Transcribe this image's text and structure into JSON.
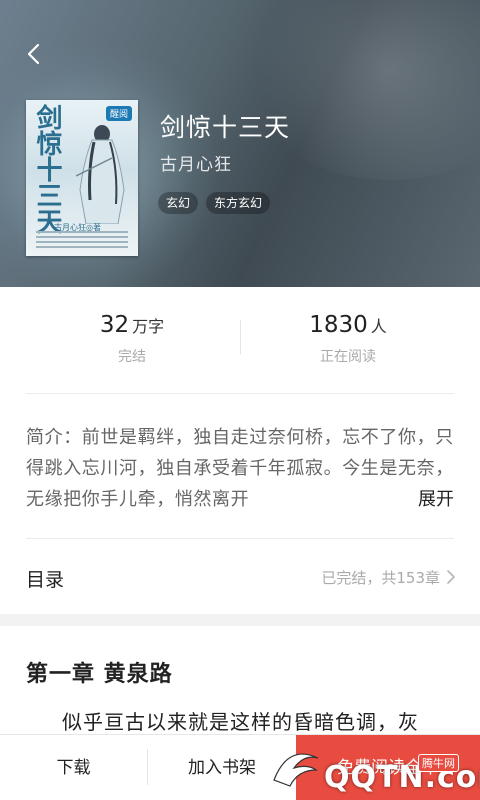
{
  "header": {
    "back_icon": "chevron-left-icon",
    "title": "剑惊十三天",
    "author": "古月心狂",
    "tags": [
      "玄幻",
      "东方玄幻"
    ]
  },
  "cover": {
    "title": "剑惊十三天",
    "badge": "醒阅",
    "author_line": "古月心狂◎著"
  },
  "stats": {
    "words": {
      "value": "32",
      "unit": "万字",
      "label": "完结"
    },
    "readers": {
      "value": "1830",
      "unit": "人",
      "label": "正在阅读"
    }
  },
  "intro": {
    "text": "简介：前世是羁绊，独自走过奈何桥，忘不了你，只得跳入忘川河，独自承受着千年孤寂。今生是无奈，无缘把你手儿牵，悄然离开",
    "expand_label": "展开"
  },
  "toc": {
    "label": "目录",
    "status": "已完结，共153章",
    "chevron_icon": "chevron-right-icon"
  },
  "chapter": {
    "title": "第一章 黄泉路",
    "first_line": "似乎亘古以来就是这样的昏暗色调，灰"
  },
  "bottom_bar": {
    "download": "下载",
    "add_shelf": "加入书架",
    "free_read": "免费阅读全本"
  },
  "watermark": {
    "text": "QQTN.com",
    "badge": "腾牛网"
  },
  "colors": {
    "accent": "#e84b3f",
    "hero_bg": "#56666f"
  }
}
